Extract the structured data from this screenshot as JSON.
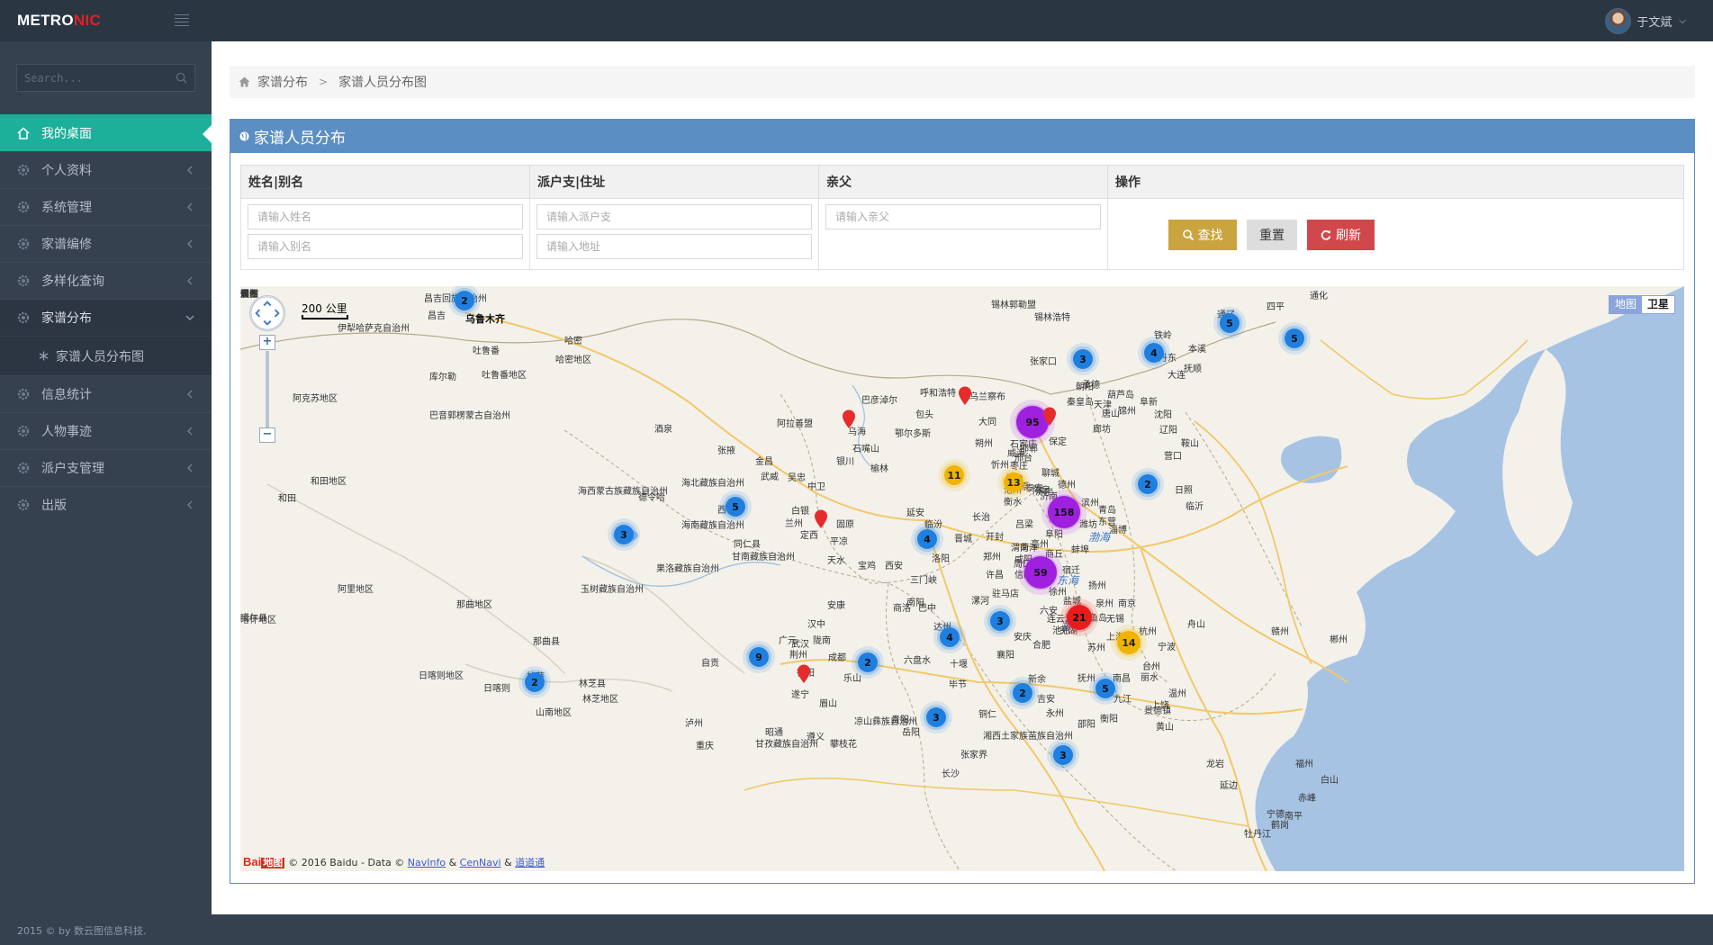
{
  "header": {
    "logo_main": "METRO",
    "logo_accent": "NIC",
    "user_name": "于文斌"
  },
  "sidebar": {
    "search_placeholder": "Search...",
    "items": [
      {
        "label": "我的桌面"
      },
      {
        "label": "个人资料"
      },
      {
        "label": "系统管理"
      },
      {
        "label": "家谱编修"
      },
      {
        "label": "多样化查询"
      },
      {
        "label": "家谱分布"
      },
      {
        "label": "信息统计"
      },
      {
        "label": "人物事迹"
      },
      {
        "label": "派户支管理"
      },
      {
        "label": "出版"
      }
    ],
    "sub_item": "家谱人员分布图"
  },
  "breadcrumb": [
    "家谱分布",
    "家谱人员分布图"
  ],
  "portlet": {
    "title": "家谱人员分布"
  },
  "filter": {
    "columns": [
      "姓名|别名",
      "派户支|住址",
      "亲父",
      "操作"
    ],
    "name_placeholder": "请输入姓名",
    "alias_placeholder": "请输入别名",
    "branch_placeholder": "请输入派户支",
    "address_placeholder": "请输入地址",
    "father_placeholder": "请输入亲父",
    "find_label": "查找",
    "reset_label": "重置",
    "refresh_label": "刷新"
  },
  "map": {
    "toggle_map": "地图",
    "toggle_satellite": "卫星",
    "scale": "200 公里",
    "attribution_prefix": "© 2016 Baidu - Data ©",
    "attr_navinfo": "NavInfo",
    "attr_amp1": "&",
    "attr_cennavi": "CenNavi",
    "attr_amp2": "&",
    "attr_daodao": "道道通",
    "logo_bai": "Bai",
    "logo_du": "地图",
    "clusters": [
      {
        "count": "2",
        "color": "#1f7fe0"
      },
      {
        "count": "3",
        "color": "#1f7fe0"
      },
      {
        "count": "4",
        "color": "#1f7fe0"
      },
      {
        "count": "5",
        "color": "#1f7fe0"
      },
      {
        "count": "5",
        "color": "#1f7fe0"
      },
      {
        "count": "95",
        "color": "#a020e0"
      },
      {
        "count": "11",
        "color": "#f0b400"
      },
      {
        "count": "13",
        "color": "#f0b400"
      },
      {
        "count": "2",
        "color": "#1f7fe0"
      },
      {
        "count": "158",
        "color": "#a020e0"
      },
      {
        "count": "5",
        "color": "#1f7fe0"
      },
      {
        "count": "3",
        "color": "#1f7fe0"
      },
      {
        "count": "4",
        "color": "#1f7fe0"
      },
      {
        "count": "59",
        "color": "#a020e0"
      },
      {
        "count": "3",
        "color": "#1f7fe0"
      },
      {
        "count": "21",
        "color": "#e81c1c"
      },
      {
        "count": "4",
        "color": "#1f7fe0"
      },
      {
        "count": "14",
        "color": "#f0b400"
      },
      {
        "count": "9",
        "color": "#1f7fe0"
      },
      {
        "count": "2",
        "color": "#1f7fe0"
      },
      {
        "count": "2",
        "color": "#1f7fe0"
      },
      {
        "count": "3",
        "color": "#1f7fe0"
      },
      {
        "count": "5",
        "color": "#1f7fe0"
      },
      {
        "count": "2",
        "color": "#1f7fe0"
      },
      {
        "count": "3",
        "color": "#1f7fe0"
      }
    ],
    "labels": [
      "乌鲁木齐",
      "昌吉回族自治州",
      "昌吉",
      "伊犁哈萨克自治州",
      "吐鲁番",
      "哈密",
      "哈密地区",
      "吐鲁番地区",
      "库尔勒",
      "阿克苏地区",
      "巴音郭楞蒙古自治州",
      "和田地区",
      "和田",
      "喀什地区",
      "锡林郭勒盟",
      "锡林浩特",
      "酒泉",
      "张掖",
      "阿拉善盟",
      "金昌",
      "武威",
      "海北藏族自治州",
      "海西蒙古族藏族自治州",
      "德令哈",
      "西宁",
      "海南藏族自治州",
      "兰州",
      "白银",
      "定西",
      "同仁县",
      "甘南藏族自治州",
      "果洛藏族自治州",
      "玉树藏族自治州",
      "阿里地区",
      "那曲地区",
      "噶尔县",
      "那曲县",
      "日喀则地区",
      "日喀则",
      "拉萨",
      "林芝县",
      "林芝地区",
      "山南地区",
      "呼和浩特",
      "乌兰察布",
      "包头",
      "乌海",
      "巴彦淖尔",
      "鄂尔多斯",
      "银川",
      "石嘴山",
      "吴忠",
      "中卫",
      "固原",
      "平凉",
      "天水",
      "宝鸡",
      "西安",
      "延安",
      "榆林",
      "忻州",
      "朔州",
      "大同",
      "太原",
      "临汾",
      "长治",
      "晋城",
      "三门峡",
      "洛阳",
      "郑州",
      "开封",
      "许昌",
      "漯河",
      "南阳",
      "商洛",
      "安康",
      "汉中",
      "陇南",
      "广元",
      "巴中",
      "达州",
      "十堰",
      "襄阳",
      "荆州",
      "武汉",
      "成都",
      "德阳",
      "遂宁",
      "眉山",
      "乐山",
      "自贡",
      "泸州",
      "重庆",
      "甘孜藏族自治州",
      "凉山彝族自治州",
      "攀枝花",
      "昭通",
      "遵义",
      "贵阳",
      "六盘水",
      "毕节",
      "铜仁",
      "湘西土家族苗族自治州",
      "张家界",
      "长沙",
      "岳阳",
      "衡阳",
      "永州",
      "邵阳",
      "吉安",
      "新余",
      "抚州",
      "南昌",
      "九江",
      "景德镇",
      "黄山",
      "上饶",
      "丽水",
      "温州",
      "台州",
      "宁波",
      "舟山",
      "杭州",
      "上海",
      "苏州",
      "无锡",
      "南京",
      "扬州",
      "盐城",
      "连云港",
      "徐州",
      "宿迁",
      "蚌埠",
      "阜阳",
      "合肥",
      "芜湖",
      "池州",
      "安庆",
      "六安",
      "信阳",
      "驻马店",
      "周口",
      "商丘",
      "亳州",
      "济宁",
      "菏泽",
      "泰安",
      "济南",
      "聊城",
      "德州",
      "滨州",
      "东营",
      "淄博",
      "潍坊",
      "青岛",
      "日照",
      "临沂",
      "枣庄",
      "烟台",
      "威海",
      "沧州",
      "衡水",
      "石家庄",
      "邢台",
      "邯郸",
      "保定",
      "廊坊",
      "天津",
      "唐山",
      "秦皇岛",
      "承德",
      "张家口",
      "朝阳",
      "葫芦岛",
      "锦州",
      "阜新",
      "沈阳",
      "辽阳",
      "鞍山",
      "营口",
      "大连",
      "丹东",
      "本溪",
      "抚顺",
      "铁岭",
      "通辽",
      "四平",
      "通化",
      "白山",
      "赤峰",
      "牡丹江",
      "鹤岗",
      "延边",
      "龙岩",
      "南平",
      "宁德",
      "福州",
      "赣州",
      "郴州",
      "泉州",
      "钓鱼岛",
      "东海",
      "黄海",
      "渤海",
      "渭南",
      "咸阳",
      "铜川",
      "吕梁",
      "阳泉",
      "新乡",
      "焦作",
      "鹤壁",
      "安阳",
      "濮阳"
    ]
  }
}
